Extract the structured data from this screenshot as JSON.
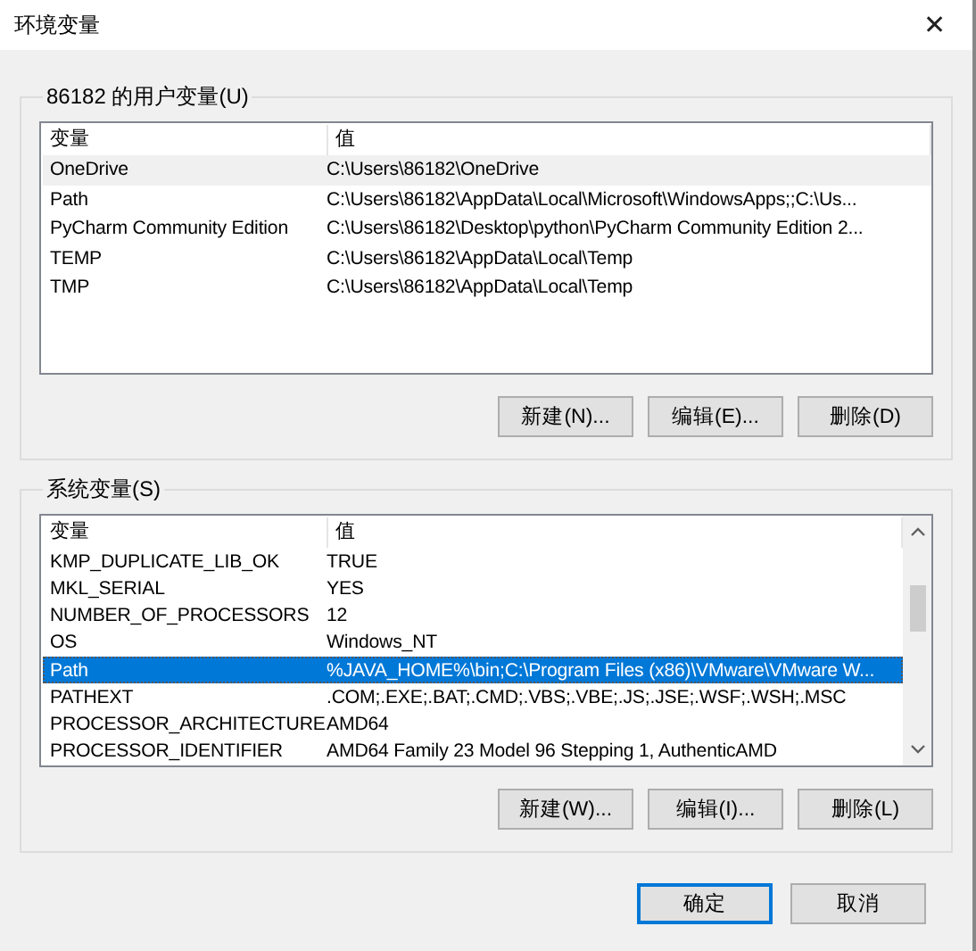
{
  "window": {
    "title": "环境变量",
    "close": "✕"
  },
  "groups": [
    {
      "legend": "86182 的用户变量(U)",
      "focused": false,
      "scrollbar": false,
      "columns": [
        "变量",
        "值"
      ],
      "rows": [
        {
          "name": "OneDrive",
          "value": "C:\\Users\\86182\\OneDrive",
          "selected": true
        },
        {
          "name": "Path",
          "value": "C:\\Users\\86182\\AppData\\Local\\Microsoft\\WindowsApps;;C:\\Us...",
          "selected": false
        },
        {
          "name": "PyCharm Community Edition",
          "value": "C:\\Users\\86182\\Desktop\\python\\PyCharm Community Edition 2...",
          "selected": false
        },
        {
          "name": "TEMP",
          "value": "C:\\Users\\86182\\AppData\\Local\\Temp",
          "selected": false
        },
        {
          "name": "TMP",
          "value": "C:\\Users\\86182\\AppData\\Local\\Temp",
          "selected": false
        }
      ],
      "buttons": [
        "新建(N)...",
        "编辑(E)...",
        "删除(D)"
      ]
    },
    {
      "legend": "系统变量(S)",
      "focused": true,
      "scrollbar": true,
      "columns": [
        "变量",
        "值"
      ],
      "rows": [
        {
          "name": "KMP_DUPLICATE_LIB_OK",
          "value": "TRUE",
          "selected": false
        },
        {
          "name": "MKL_SERIAL",
          "value": "YES",
          "selected": false
        },
        {
          "name": "NUMBER_OF_PROCESSORS",
          "value": "12",
          "selected": false
        },
        {
          "name": "OS",
          "value": "Windows_NT",
          "selected": false
        },
        {
          "name": "Path",
          "value": "%JAVA_HOME%\\bin;C:\\Program Files (x86)\\VMware\\VMware W...",
          "selected": true
        },
        {
          "name": "PATHEXT",
          "value": ".COM;.EXE;.BAT;.CMD;.VBS;.VBE;.JS;.JSE;.WSF;.WSH;.MSC",
          "selected": false
        },
        {
          "name": "PROCESSOR_ARCHITECTURE",
          "value": "AMD64",
          "selected": false
        },
        {
          "name": "PROCESSOR_IDENTIFIER",
          "value": "AMD64 Family 23 Model 96 Stepping 1, AuthenticAMD",
          "selected": false
        }
      ],
      "buttons": [
        "新建(W)...",
        "编辑(I)...",
        "删除(L)"
      ]
    }
  ],
  "footer_buttons": [
    {
      "label": "确定",
      "default": true
    },
    {
      "label": "取消",
      "default": false
    }
  ]
}
